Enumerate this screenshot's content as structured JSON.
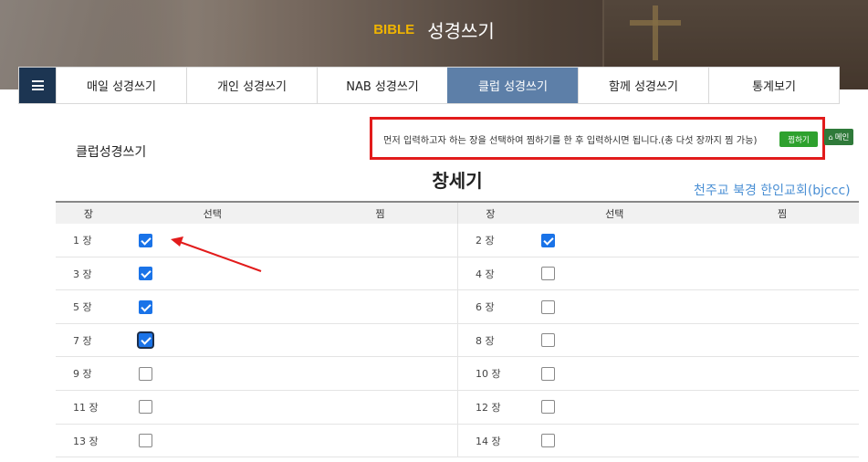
{
  "hero": {
    "tag": "BIBLE",
    "title": "성경쓰기"
  },
  "nav": {
    "menu_icon": "hamburger-icon",
    "tabs": [
      "매일 성경쓰기",
      "개인 성경쓰기",
      "NAB 성경쓰기",
      "클럽 성경쓰기",
      "함께 성경쓰기",
      "통계보기"
    ],
    "active_tab": "클럽 성경쓰기"
  },
  "section_title": "클럽성경쓰기",
  "notice": {
    "text": "먼저 입력하고자 하는 장을 선택하여 찜하기를 한 후 입력하시면 됩니다.(총 다섯 장까지 찜 가능)",
    "pick_button": "찜하기",
    "main_button": "메인",
    "main_icon": "home-icon"
  },
  "book_title": "창세기",
  "church_name": "천주교 북경 한인교회(bjccc)",
  "table": {
    "headers": [
      "장",
      "선택",
      "찜",
      "장",
      "선택",
      "찜"
    ],
    "rows": [
      {
        "left": {
          "chapter": "1 장",
          "checked": true
        },
        "right": {
          "chapter": "2 장",
          "checked": true
        }
      },
      {
        "left": {
          "chapter": "3 장",
          "checked": true
        },
        "right": {
          "chapter": "4 장",
          "checked": false
        }
      },
      {
        "left": {
          "chapter": "5 장",
          "checked": true
        },
        "right": {
          "chapter": "6 장",
          "checked": false
        }
      },
      {
        "left": {
          "chapter": "7 장",
          "checked": true
        },
        "right": {
          "chapter": "8 장",
          "checked": false
        }
      },
      {
        "left": {
          "chapter": "9 장",
          "checked": false
        },
        "right": {
          "chapter": "10 장",
          "checked": false
        }
      },
      {
        "left": {
          "chapter": "11 장",
          "checked": false
        },
        "right": {
          "chapter": "12 장",
          "checked": false
        }
      },
      {
        "left": {
          "chapter": "13 장",
          "checked": false
        },
        "right": {
          "chapter": "14 장",
          "checked": false
        }
      }
    ]
  },
  "colors": {
    "nav_dark": "#1c3552",
    "nav_active": "#5d7fa8",
    "highlight_box": "#e21b1b",
    "checkbox_on": "#1a73e8",
    "church": "#4a8fd4",
    "bible_tag": "#f0b400"
  }
}
